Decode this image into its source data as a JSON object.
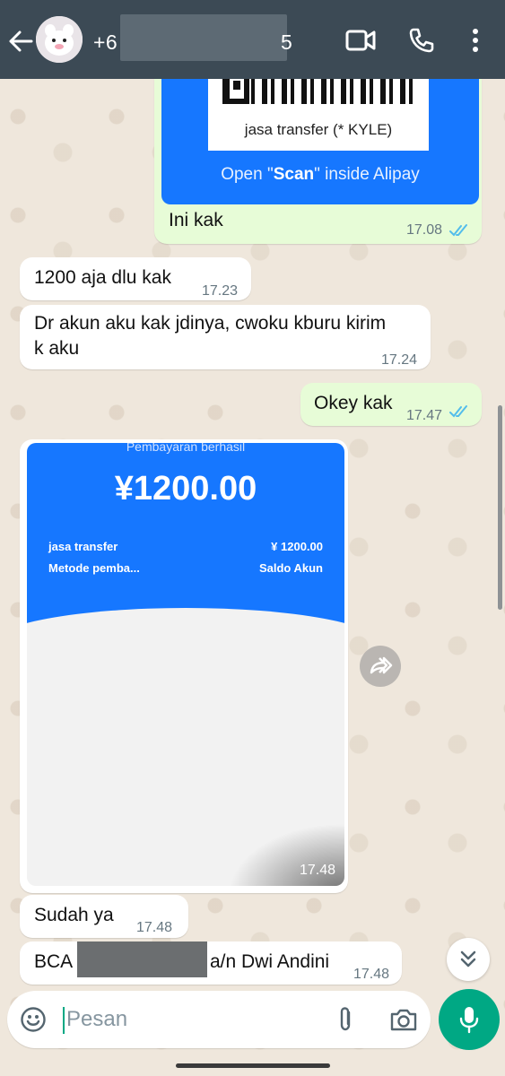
{
  "header": {
    "contact_prefix": "+6",
    "contact_suffix": "5"
  },
  "messages": {
    "qr": {
      "caption": "jasa transfer (* KYLE)",
      "scan_prefix": "Open \"",
      "scan_word": "Scan",
      "scan_suffix": "\" inside Alipay"
    },
    "m1": {
      "text": "Ini kak",
      "time": "17.08"
    },
    "m2": {
      "text": "1200 aja dlu kak",
      "time": "17.23"
    },
    "m3": {
      "line1": "Dr akun aku kak jdinya, cwoku kburu kirim",
      "line2": "k aku",
      "time": "17.24"
    },
    "m4": {
      "text": "Okey kak",
      "time": "17.47"
    },
    "payment": {
      "status": "Pembayaran berhasil",
      "amount": "¥1200.00",
      "merchant": "jasa transfer",
      "merchant_amount": "¥ 1200.00",
      "method": "Metode pemba...",
      "balance": "Saldo Akun",
      "time": "17.48"
    },
    "m5": {
      "text": "Sudah ya",
      "time": "17.48"
    },
    "m6": {
      "prefix": "BCA",
      "suffix": "a/n Dwi Andini",
      "time": "17.48"
    }
  },
  "input": {
    "placeholder": "Pesan"
  },
  "colors": {
    "header": "#3c4a55",
    "outgoing_bubble": "#e7fcd7",
    "incoming_bubble": "#ffffff",
    "accent": "#00a884",
    "read_ticks": "#53bdeb",
    "alipay_blue": "#1677ff"
  },
  "icons": [
    "back-arrow-icon",
    "video-call-icon",
    "phone-icon",
    "more-vert-icon",
    "double-check-icon",
    "forward-icon",
    "chevron-double-down-icon",
    "emoji-icon",
    "attach-icon",
    "camera-icon",
    "mic-icon"
  ]
}
